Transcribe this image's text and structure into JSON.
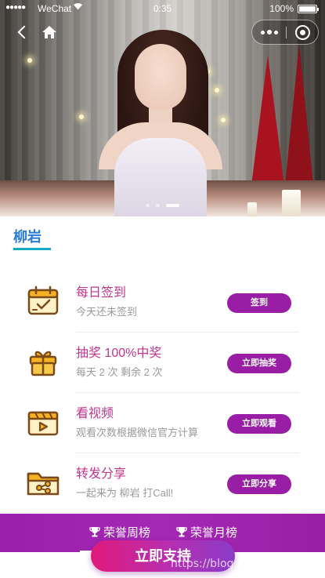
{
  "status_bar": {
    "signal": "●●●●●",
    "carrier": "WeChat",
    "time": "0:35",
    "battery": "100%"
  },
  "colors": {
    "accent_purple": "#9a1ea5",
    "title_pink": "#c2358f",
    "name_blue": "#2a7bd9",
    "support_gradient": [
      "#e01a7c",
      "#8a3bc8"
    ]
  },
  "icons": {
    "back": "chevron-left-icon",
    "home": "home-icon",
    "more": "more-dots-icon",
    "close": "close-circle-icon",
    "checkin": "calendar-check-icon",
    "lottery": "gift-icon",
    "video": "video-play-icon",
    "share": "folder-share-icon",
    "trophy": "trophy-icon"
  },
  "carousel": {
    "slide_count": 3,
    "active_index": 2
  },
  "profile": {
    "name": "柳岩"
  },
  "tasks": [
    {
      "title": "每日签到",
      "subtitle": "今天还未签到",
      "button": "签到"
    },
    {
      "title": "抽奖 100%中奖",
      "subtitle": "每天 2 次 剩余 2 次",
      "button": "立即抽奖"
    },
    {
      "title": "看视频",
      "subtitle": "观看次数根据微信官方计算",
      "button": "立即观看"
    },
    {
      "title": "转发分享",
      "subtitle": "一起来为 柳岩 打Call!",
      "button": "立即分享"
    }
  ],
  "bottom": {
    "weekly": "荣誉周榜",
    "monthly": "荣誉月榜",
    "support": "立即支持"
  },
  "watermark": "https://blog.csdn.net/mygia"
}
